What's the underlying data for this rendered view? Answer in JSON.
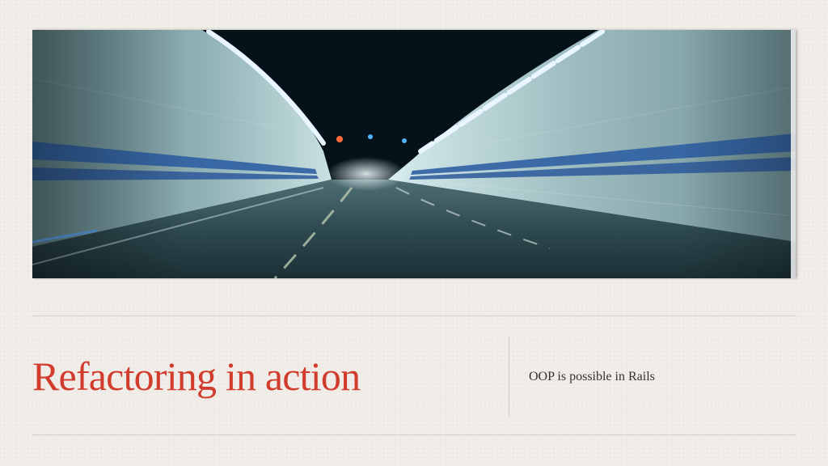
{
  "slide": {
    "title": "Refactoring in action",
    "subtitle": "OOP is possible in Rails",
    "image": {
      "subject": "tunnel-photo"
    },
    "colors": {
      "background": "#efebe6",
      "title": "#d13c2c",
      "subtitle": "#333333",
      "rule": "#d6d1cb",
      "tunnel_stripe": "#2f5fa3",
      "tunnel_wall": "#7fa3a8"
    }
  }
}
